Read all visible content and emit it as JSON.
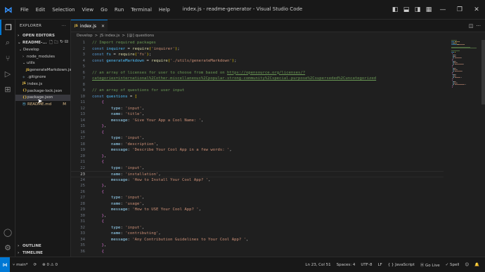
{
  "window": {
    "title": "index.js - readme-generator - Visual Studio Code",
    "menu": [
      "File",
      "Edit",
      "Selection",
      "View",
      "Go",
      "Run",
      "Terminal",
      "Help"
    ]
  },
  "sidebar": {
    "header": "EXPLORER",
    "open_editors": "OPEN EDITORS",
    "project": "README-...",
    "tree": [
      {
        "label": "Develop",
        "icon": "chevron-down-icon",
        "indent": 1,
        "kind": "folder"
      },
      {
        "label": "node_modules",
        "icon": "chevron-right-icon",
        "indent": 2,
        "kind": "folder"
      },
      {
        "label": "utils",
        "icon": "chevron-down-icon",
        "indent": 2,
        "kind": "folder"
      },
      {
        "label": "generateMarkdown.js",
        "icon": "js-file-icon",
        "indent": 3,
        "kind": "js"
      },
      {
        "label": ".gitignore",
        "icon": "git-file-icon",
        "indent": 2,
        "kind": "git"
      },
      {
        "label": "index.js",
        "icon": "js-file-icon",
        "indent": 2,
        "kind": "js"
      },
      {
        "label": "package-lock.json",
        "icon": "json-file-icon",
        "indent": 2,
        "kind": "json"
      },
      {
        "label": "package.json",
        "icon": "json-file-icon",
        "indent": 2,
        "kind": "json",
        "selected": true
      },
      {
        "label": "README.md",
        "icon": "markdown-file-icon",
        "indent": 2,
        "kind": "md",
        "badge": "M"
      }
    ],
    "outline": "OUTLINE",
    "timeline": "TIMELINE"
  },
  "editor": {
    "tab_label": "index.js",
    "tab_badge": "JS",
    "breadcrumb": [
      "Develop",
      ">",
      "JS index.js",
      ">",
      "[@] questions"
    ],
    "active_line": 23,
    "lines": [
      [
        {
          "t": "// Import required packages",
          "c": "com"
        }
      ],
      [
        {
          "t": "const ",
          "c": "kw"
        },
        {
          "t": "inquirer",
          "c": "var"
        },
        {
          "t": " = ",
          "c": "pn"
        },
        {
          "t": "require",
          "c": "fn"
        },
        {
          "t": "(",
          "c": "br1"
        },
        {
          "t": "'inquirer'",
          "c": "str"
        },
        {
          "t": ")",
          "c": "br1"
        },
        {
          "t": ";",
          "c": "pn"
        }
      ],
      [
        {
          "t": "const ",
          "c": "kw"
        },
        {
          "t": "fs",
          "c": "var"
        },
        {
          "t": " = ",
          "c": "pn"
        },
        {
          "t": "require",
          "c": "fn"
        },
        {
          "t": "(",
          "c": "br1"
        },
        {
          "t": "'fs'",
          "c": "str"
        },
        {
          "t": ")",
          "c": "br1"
        },
        {
          "t": ";",
          "c": "pn"
        }
      ],
      [
        {
          "t": "const ",
          "c": "kw"
        },
        {
          "t": "generateMarkdown",
          "c": "var"
        },
        {
          "t": " = ",
          "c": "pn"
        },
        {
          "t": "require",
          "c": "fn"
        },
        {
          "t": "(",
          "c": "br1"
        },
        {
          "t": "'./utils/generateMarkdown'",
          "c": "str"
        },
        {
          "t": ")",
          "c": "br1"
        },
        {
          "t": ";",
          "c": "pn"
        }
      ],
      [],
      [
        {
          "t": "// an array of licenses for user to choose from based on ",
          "c": "com"
        },
        {
          "t": "https://opensource.org/licenses/?",
          "c": "link"
        }
      ],
      [
        {
          "t": "categories=international%2Cother-miscellaneous%2Cpopular-strong-community%2Cspecial-purpose%2Csuperseded%2Cuncategorized",
          "c": "link"
        }
      ],
      [],
      [
        {
          "t": "// an array of questions for user input",
          "c": "com"
        }
      ],
      [
        {
          "t": "const ",
          "c": "kw"
        },
        {
          "t": "questions",
          "c": "var"
        },
        {
          "t": " = ",
          "c": "pn"
        },
        {
          "t": "[",
          "c": "br1"
        }
      ],
      [
        {
          "t": "    ",
          "c": "pn"
        },
        {
          "t": "{",
          "c": "br2"
        }
      ],
      [
        {
          "t": "        ",
          "c": "pn"
        },
        {
          "t": "type",
          "c": "prop"
        },
        {
          "t": ": ",
          "c": "pn"
        },
        {
          "t": "'input'",
          "c": "str"
        },
        {
          "t": ",",
          "c": "pn"
        }
      ],
      [
        {
          "t": "        ",
          "c": "pn"
        },
        {
          "t": "name",
          "c": "prop"
        },
        {
          "t": ": ",
          "c": "pn"
        },
        {
          "t": "'title'",
          "c": "str"
        },
        {
          "t": ",",
          "c": "pn"
        }
      ],
      [
        {
          "t": "        ",
          "c": "pn"
        },
        {
          "t": "message",
          "c": "prop"
        },
        {
          "t": ": ",
          "c": "pn"
        },
        {
          "t": "'Give Your App a Cool Name: '",
          "c": "str"
        },
        {
          "t": ",",
          "c": "pn"
        }
      ],
      [
        {
          "t": "    ",
          "c": "pn"
        },
        {
          "t": "}",
          "c": "br2"
        },
        {
          "t": ",",
          "c": "pn"
        }
      ],
      [
        {
          "t": "    ",
          "c": "pn"
        },
        {
          "t": "{",
          "c": "br2"
        }
      ],
      [
        {
          "t": "        ",
          "c": "pn"
        },
        {
          "t": "type",
          "c": "prop"
        },
        {
          "t": ": ",
          "c": "pn"
        },
        {
          "t": "'input'",
          "c": "str"
        },
        {
          "t": ",",
          "c": "pn"
        }
      ],
      [
        {
          "t": "        ",
          "c": "pn"
        },
        {
          "t": "name",
          "c": "prop"
        },
        {
          "t": ": ",
          "c": "pn"
        },
        {
          "t": "'description'",
          "c": "str"
        },
        {
          "t": ",",
          "c": "pn"
        }
      ],
      [
        {
          "t": "        ",
          "c": "pn"
        },
        {
          "t": "message",
          "c": "prop"
        },
        {
          "t": ": ",
          "c": "pn"
        },
        {
          "t": "'Describe Your Cool App in a few words: '",
          "c": "str"
        },
        {
          "t": ",",
          "c": "pn"
        }
      ],
      [
        {
          "t": "    ",
          "c": "pn"
        },
        {
          "t": "}",
          "c": "br2"
        },
        {
          "t": ",",
          "c": "pn"
        }
      ],
      [
        {
          "t": "    ",
          "c": "pn"
        },
        {
          "t": "{",
          "c": "br2"
        }
      ],
      [
        {
          "t": "        ",
          "c": "pn"
        },
        {
          "t": "type",
          "c": "prop"
        },
        {
          "t": ": ",
          "c": "pn"
        },
        {
          "t": "'input'",
          "c": "str"
        },
        {
          "t": ",",
          "c": "pn"
        }
      ],
      [
        {
          "t": "        ",
          "c": "pn"
        },
        {
          "t": "name",
          "c": "prop"
        },
        {
          "t": ": ",
          "c": "pn"
        },
        {
          "t": "'installation'",
          "c": "str"
        },
        {
          "t": ",",
          "c": "pn"
        }
      ],
      [
        {
          "t": "        ",
          "c": "pn"
        },
        {
          "t": "message",
          "c": "prop"
        },
        {
          "t": ": ",
          "c": "pn"
        },
        {
          "t": "'How to Install Your Cool App? '",
          "c": "str"
        },
        {
          "t": ",",
          "c": "pn"
        }
      ],
      [
        {
          "t": "    ",
          "c": "pn"
        },
        {
          "t": "}",
          "c": "br2"
        },
        {
          "t": ",",
          "c": "pn"
        }
      ],
      [
        {
          "t": "    ",
          "c": "pn"
        },
        {
          "t": "{",
          "c": "br2"
        }
      ],
      [
        {
          "t": "        ",
          "c": "pn"
        },
        {
          "t": "type",
          "c": "prop"
        },
        {
          "t": ": ",
          "c": "pn"
        },
        {
          "t": "'input'",
          "c": "str"
        },
        {
          "t": ",",
          "c": "pn"
        }
      ],
      [
        {
          "t": "        ",
          "c": "pn"
        },
        {
          "t": "name",
          "c": "prop"
        },
        {
          "t": ": ",
          "c": "pn"
        },
        {
          "t": "'usage'",
          "c": "str"
        },
        {
          "t": ",",
          "c": "pn"
        }
      ],
      [
        {
          "t": "        ",
          "c": "pn"
        },
        {
          "t": "message",
          "c": "prop"
        },
        {
          "t": ": ",
          "c": "pn"
        },
        {
          "t": "'How to USE Your Cool App? '",
          "c": "str"
        },
        {
          "t": ",",
          "c": "pn"
        }
      ],
      [
        {
          "t": "    ",
          "c": "pn"
        },
        {
          "t": "}",
          "c": "br2"
        },
        {
          "t": ",",
          "c": "pn"
        }
      ],
      [
        {
          "t": "    ",
          "c": "pn"
        },
        {
          "t": "{",
          "c": "br2"
        }
      ],
      [
        {
          "t": "        ",
          "c": "pn"
        },
        {
          "t": "type",
          "c": "prop"
        },
        {
          "t": ": ",
          "c": "pn"
        },
        {
          "t": "'input'",
          "c": "str"
        },
        {
          "t": ",",
          "c": "pn"
        }
      ],
      [
        {
          "t": "        ",
          "c": "pn"
        },
        {
          "t": "name",
          "c": "prop"
        },
        {
          "t": ": ",
          "c": "pn"
        },
        {
          "t": "'contributing'",
          "c": "str"
        },
        {
          "t": ",",
          "c": "pn"
        }
      ],
      [
        {
          "t": "        ",
          "c": "pn"
        },
        {
          "t": "message",
          "c": "prop"
        },
        {
          "t": ": ",
          "c": "pn"
        },
        {
          "t": "'Any Contribution Guidelines to Your Cool App? '",
          "c": "str"
        },
        {
          "t": ",",
          "c": "pn"
        }
      ],
      [
        {
          "t": "    ",
          "c": "pn"
        },
        {
          "t": "}",
          "c": "br2"
        },
        {
          "t": ",",
          "c": "pn"
        }
      ],
      [
        {
          "t": "    ",
          "c": "pn"
        },
        {
          "t": "{",
          "c": "br2"
        }
      ]
    ]
  },
  "statusbar": {
    "branch": "main*",
    "problems": "⊗ 0 ⚠ 0",
    "position": "Ln 23, Col 51",
    "spaces": "Spaces: 4",
    "encoding": "UTF-8",
    "eol": "LF",
    "language": "{ } JavaScript",
    "golive": "Go Live",
    "spell": "✓ Spell"
  },
  "colors": {
    "accent": "#0078d4",
    "background": "#1f1f1f",
    "chrome": "#181818"
  }
}
